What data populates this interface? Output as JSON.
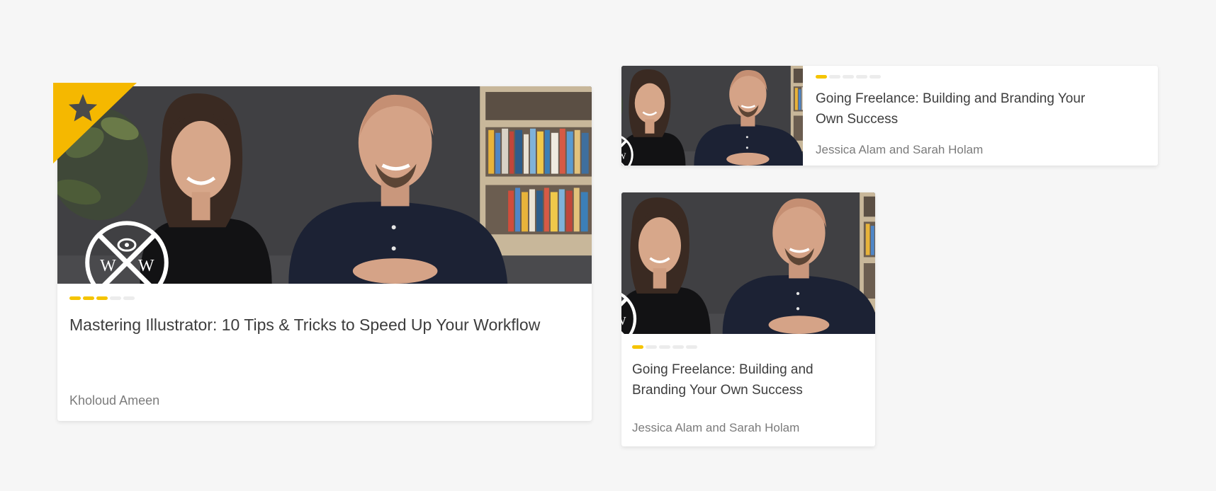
{
  "colors": {
    "background": "#f6f6f6",
    "accent": "#f5c400",
    "title": "#3d3d3d",
    "author": "#7b7b7b"
  },
  "courses": {
    "featured": {
      "badge_icon": "star-icon",
      "title": "Mastering Illustrator: 10 Tips & Tricks to Speed Up Your Workflow",
      "author": "Kholoud Ameen",
      "rating_filled": 3,
      "rating_total": 5
    },
    "horizontal": {
      "title": "Going Freelance: Building and Branding Your Own Success",
      "author": "Jessica Alam and Sarah Holam",
      "rating_filled": 1,
      "rating_total": 5
    },
    "small": {
      "title": "Going Freelance: Building and Branding Your Own Success",
      "author": "Jessica Alam and Sarah Holam",
      "rating_filled": 1,
      "rating_total": 5
    }
  }
}
